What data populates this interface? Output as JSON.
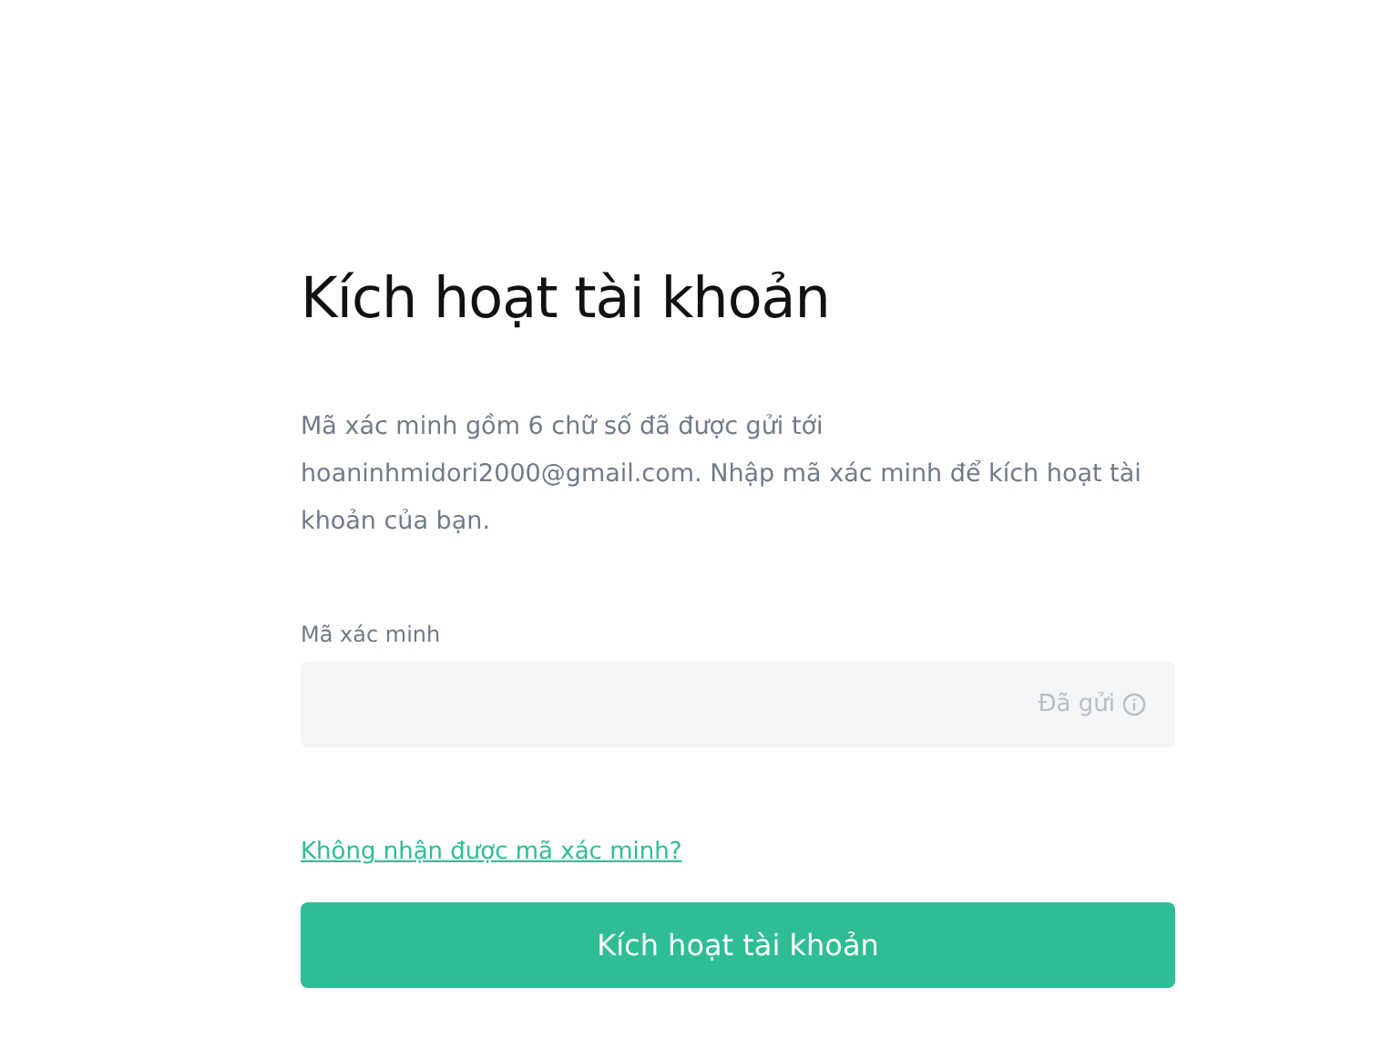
{
  "title": "Kích hoạt tài khoản",
  "description": "Mã xác minh gồm 6 chữ số đã được gửi tới hoaninhmidori2000@gmail.com. Nhập mã xác minh để kích hoạt tài khoản của bạn.",
  "field": {
    "label": "Mã xác minh",
    "status": "Đã gửi"
  },
  "link": "Không nhận được mã xác minh?",
  "button": "Kích hoạt tài khoản"
}
